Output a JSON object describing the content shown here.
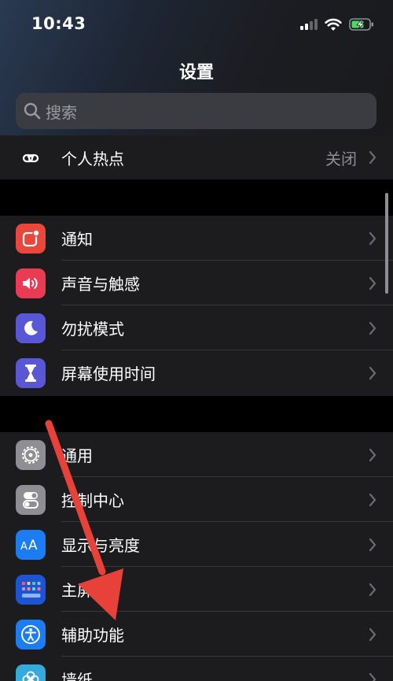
{
  "status_bar": {
    "time": "10:43"
  },
  "header": {
    "title": "设置"
  },
  "search": {
    "placeholder": "搜索"
  },
  "groups": [
    {
      "items": [
        {
          "label": "个人热点",
          "value": "关闭",
          "icon": "hotspot-icon",
          "color": "#34c759"
        }
      ]
    },
    {
      "items": [
        {
          "label": "通知",
          "icon": "notifications-icon",
          "color": "#e9473c"
        },
        {
          "label": "声音与触感",
          "icon": "speaker-icon",
          "color": "#e93b54"
        },
        {
          "label": "勿扰模式",
          "icon": "moon-icon",
          "color": "#5a57d6"
        },
        {
          "label": "屏幕使用时间",
          "icon": "hourglass-icon",
          "color": "#5a57d6"
        }
      ]
    },
    {
      "items": [
        {
          "label": "通用",
          "icon": "gear-icon",
          "color": "#8e8e93"
        },
        {
          "label": "控制中心",
          "icon": "toggle-icon",
          "color": "#8e8e93"
        },
        {
          "label": "显示与亮度",
          "icon": "text-size-icon",
          "color": "#1c7cf4"
        },
        {
          "label": "主屏幕",
          "icon": "home-grid-icon",
          "color": "#1c54d4"
        },
        {
          "label": "辅助功能",
          "icon": "accessibility-icon",
          "color": "#1c7cf4"
        },
        {
          "label": "墙纸",
          "icon": "wallpaper-icon",
          "color": "#35aadc"
        }
      ]
    }
  ],
  "annotation": {
    "icon": "red-arrow-icon",
    "color": "#e8413a"
  }
}
